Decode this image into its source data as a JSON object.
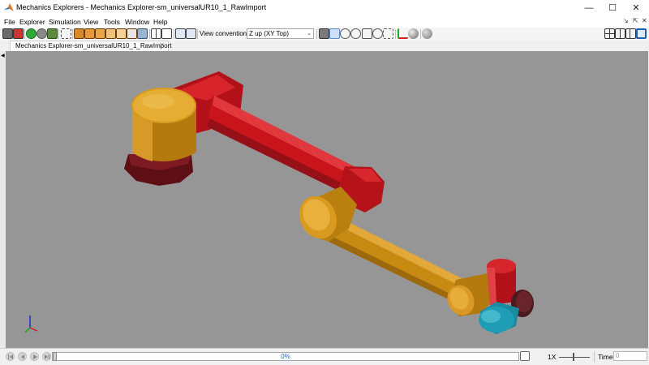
{
  "window": {
    "app_title": "Mechanics Explorers",
    "separator": " - ",
    "document_title": "Mechanics Explorer-sm_universalUR10_1_RawImport",
    "minimize_glyph": "—",
    "maximize_glyph": "☐",
    "close_glyph": "✕"
  },
  "menu": {
    "items": [
      "File",
      "Explorer",
      "Simulation",
      "View",
      "Tools",
      "Window",
      "Help"
    ],
    "undock_glyph": "↘",
    "pin_glyph": "⇱",
    "close_glyph": "✕"
  },
  "toolbar": {
    "view_convention_label": "View convention:",
    "view_convention_value": "Z up (XY Top)",
    "dropdown_glyph": "⌄"
  },
  "tabs": [
    {
      "label": "Mechanics Explorer-sm_universalUR10_1_RawImport",
      "close_glyph": "✕"
    }
  ],
  "sidebar": {
    "collapse_glyph": "◀"
  },
  "playback": {
    "progress_percent": 0,
    "progress_text": "0%",
    "speed_label": "1X",
    "time_label": "Time",
    "time_value": "0"
  },
  "colors": {
    "viewport_background": "#969696",
    "robot_red": "#c8141a",
    "robot_gold": "#c98a14",
    "robot_cyan": "#1f9db4",
    "base_dark": "#5e0f16",
    "progress_text": "#1e66c8"
  },
  "icons": {
    "toolbar_left": [
      "model-browser-icon",
      "scene-icon",
      "run-icon",
      "stop-icon",
      "save-icon",
      "fit-view-icon",
      "front-view-icon",
      "back-view-icon",
      "left-view-icon",
      "right-view-icon",
      "top-view-icon",
      "bottom-view-icon",
      "isometric-view-icon",
      "grid-view-icon",
      "box-view-icon",
      "expand-icon",
      "collapse-icon"
    ],
    "toolbar_right": [
      "camera-icon",
      "select-icon",
      "orbit-icon",
      "roll-icon",
      "pan-icon",
      "zoom-icon",
      "zoom-box-icon",
      "frames-icon",
      "sphere-icon",
      "lighting-icon"
    ],
    "layout": [
      "layout-four-icon",
      "layout-two-icon",
      "layout-three-icon",
      "layout-single-icon"
    ],
    "playback": [
      "skip-start-icon",
      "step-back-icon",
      "play-icon",
      "step-forward-icon",
      "record-icon"
    ],
    "axes": "axes-triad-icon"
  }
}
